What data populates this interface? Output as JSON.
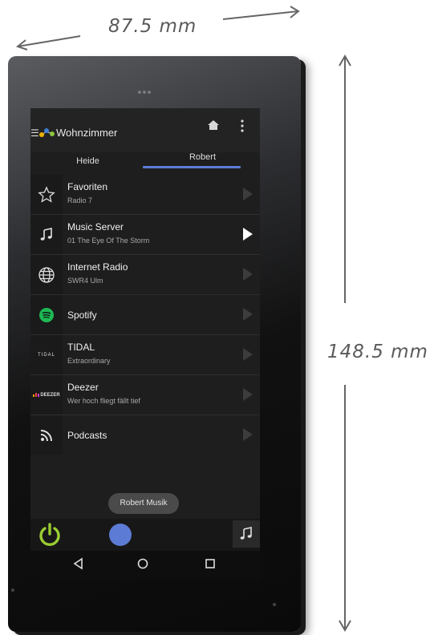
{
  "dimensions": {
    "width_label": "87.5 mm",
    "height_label": "148.5 mm"
  },
  "app": {
    "room_title": "Wohnzimmer",
    "tabs": [
      {
        "label": "Heide",
        "active": false
      },
      {
        "label": "Robert",
        "active": true
      }
    ],
    "accent_color": "#5b7dd6"
  },
  "sources": [
    {
      "title": "Favoriten",
      "subtitle": "Radio 7",
      "icon": "star-icon",
      "playing": false
    },
    {
      "title": "Music Server",
      "subtitle": "01 The Eye Of The Storm",
      "icon": "music-note-icon",
      "playing": true
    },
    {
      "title": "Internet Radio",
      "subtitle": "SWR4 Ulm",
      "icon": "globe-icon",
      "playing": false
    },
    {
      "title": "Spotify",
      "subtitle": "",
      "icon": "spotify-icon",
      "playing": false
    },
    {
      "title": "TIDAL",
      "subtitle": "Extraordinary",
      "icon": "tidal-logo-icon",
      "playing": false
    },
    {
      "title": "Deezer",
      "subtitle": "Wer hoch fliegt fällt tief",
      "icon": "deezer-logo-icon",
      "playing": false
    },
    {
      "title": "Podcasts",
      "subtitle": "",
      "icon": "rss-icon",
      "playing": false
    }
  ],
  "logos": {
    "tidal": "TIDAL",
    "deezer": "DEEZER"
  },
  "toast": "Robert Musik",
  "colors": {
    "power": "#9acd32",
    "player_dot": "#5c7bd4",
    "spotify": "#1db954"
  }
}
